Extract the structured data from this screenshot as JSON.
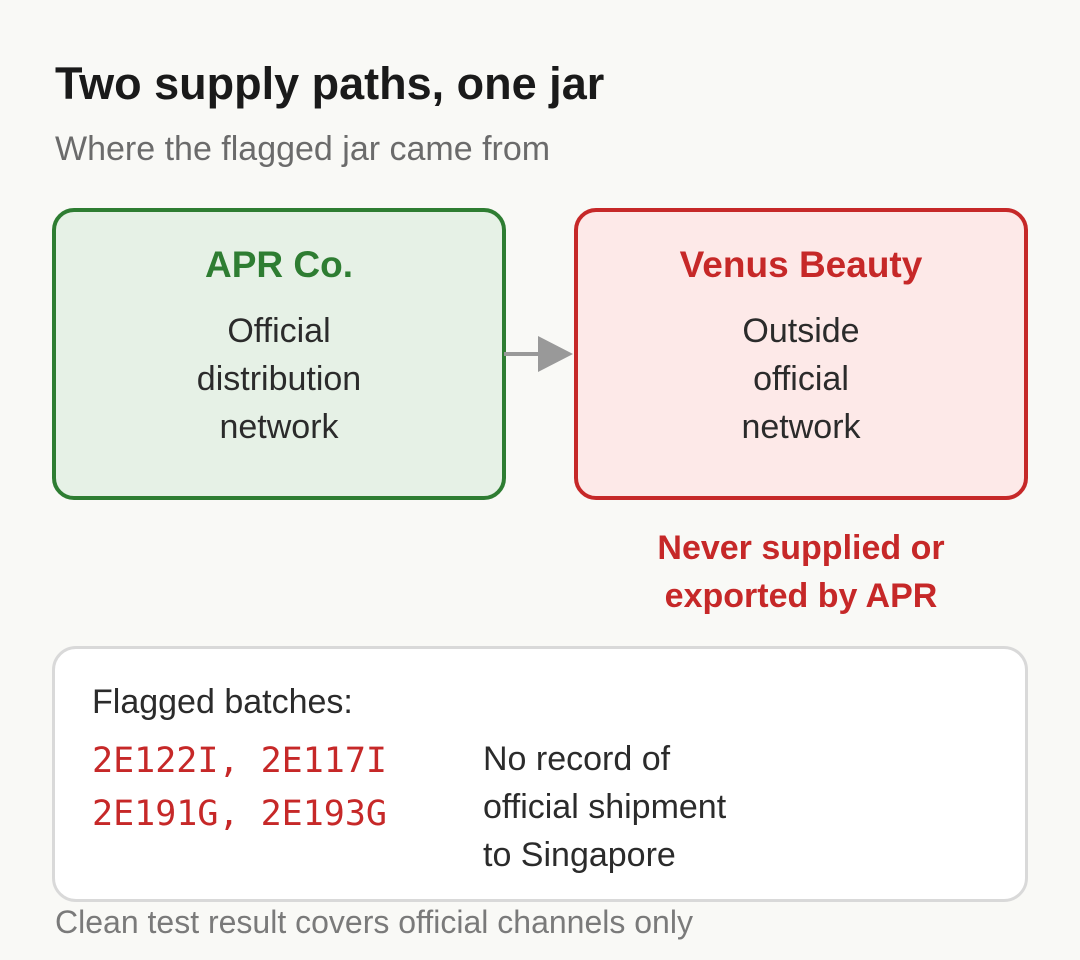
{
  "header": {
    "title": "Two supply paths, one jar",
    "subtitle": "Where the flagged jar came from"
  },
  "sources": [
    {
      "name": "APR Co.",
      "description_lines": [
        "Official",
        "distribution",
        "network"
      ],
      "color": "#2e7d32",
      "fill": "#e6f1e6"
    },
    {
      "name": "Venus Beauty",
      "description_lines": [
        "Outside",
        "official",
        "network"
      ],
      "color": "#c62828",
      "fill": "#fde9e8"
    }
  ],
  "connector": {
    "from": "APR Co.",
    "to": "Venus Beauty",
    "color": "#999999"
  },
  "warning": {
    "lines": [
      "Never supplied or",
      "exported by APR"
    ]
  },
  "batches": {
    "label": "Flagged batches:",
    "code_lines": [
      "2E122I, 2E117I",
      "2E191G, 2E193G"
    ],
    "note_lines": [
      "No record of",
      "official shipment",
      "to Singapore"
    ]
  },
  "footnote": "Clean test result covers official channels only"
}
